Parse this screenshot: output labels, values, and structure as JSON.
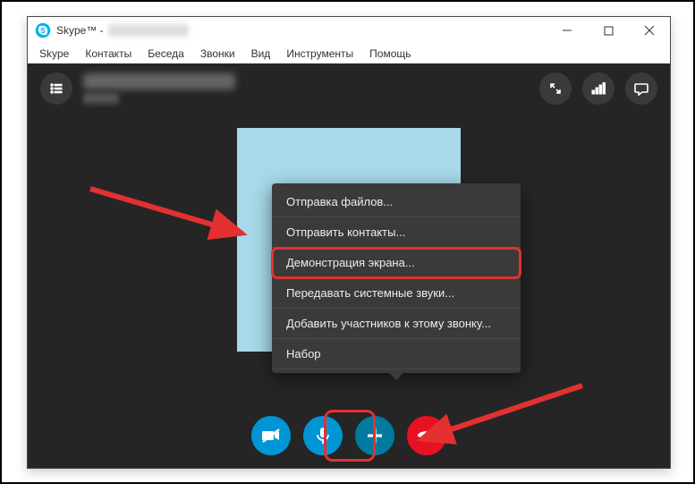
{
  "window": {
    "title_prefix": "Skype™ - "
  },
  "menu": {
    "items": [
      "Skype",
      "Контакты",
      "Беседа",
      "Звонки",
      "Вид",
      "Инструменты",
      "Помощь"
    ]
  },
  "popup": {
    "items": [
      "Отправка файлов...",
      "Отправить контакты...",
      "Демонстрация экрана...",
      "Передавать системные звуки...",
      "Добавить участников к этому звонку...",
      "Набор"
    ],
    "highlight_index": 2
  },
  "controls": {
    "video_label": "toggle-video",
    "mic_label": "toggle-mic",
    "add_label": "add-actions",
    "end_label": "end-call"
  },
  "header": {
    "list_btn": "conversation-list",
    "fullscreen": "fullscreen",
    "quality": "call-quality",
    "chat": "open-chat"
  }
}
